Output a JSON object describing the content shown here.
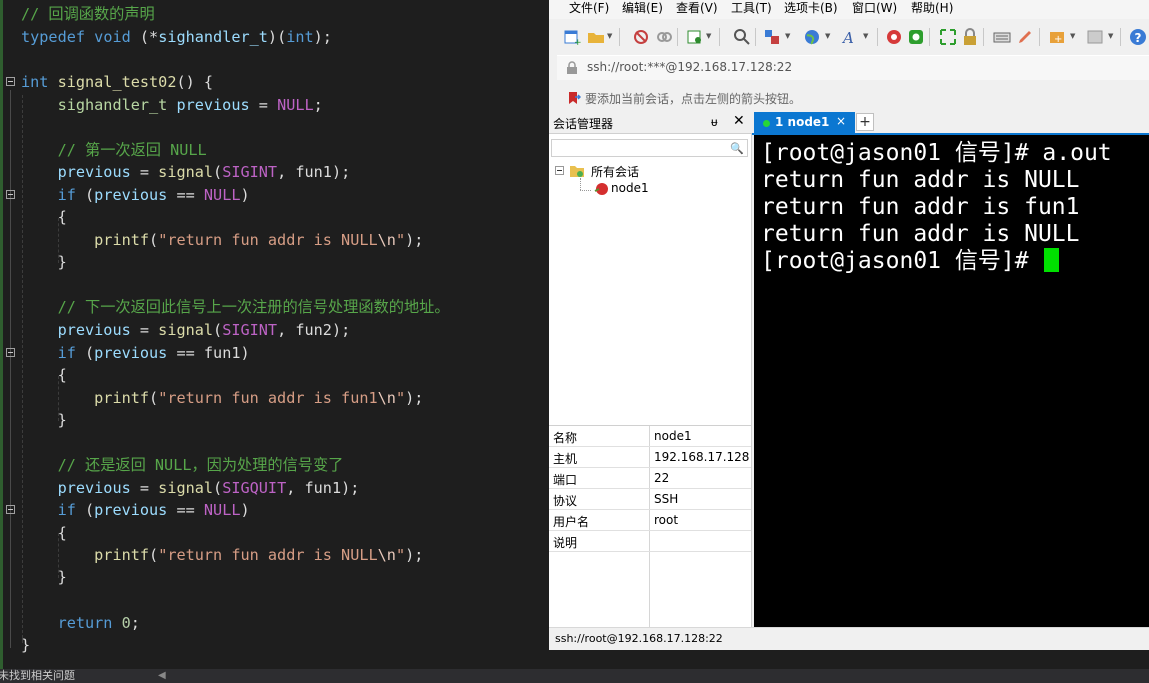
{
  "editor": {
    "lines": [
      {
        "cm": "// 回调函数的声明"
      },
      {
        "kw": "typedef",
        "ty": "void",
        "rest_a": " (*",
        "id": "sighandler_t",
        "rest_b": ")(",
        "kw2": "int",
        "rest_c": ");"
      },
      {},
      {
        "kw": "int",
        "fn": "signal_test02",
        "rest": "() {"
      },
      {
        "ty": "sighandler_t",
        "vr": "previous",
        "rest": " = ",
        "mc": "NULL",
        "end": ";"
      },
      {},
      {
        "cm": "// 第一次返回 NULL"
      },
      {
        "vr": "previous",
        "rest": " = ",
        "fn": "signal",
        "args": "SIGINT",
        "args2": "fun1",
        "end": ");"
      },
      {
        "kw": "if",
        "vr": "previous",
        "mc": "NULL"
      },
      {
        "p": "{"
      },
      {
        "fn": "printf",
        "st": "\"return fun addr is NULL",
        "es": "\\n",
        "st2": "\"",
        "end": ");"
      },
      {
        "p": "}"
      },
      {},
      {
        "cm": "// 下一次返回此信号上一次注册的信号处理函数的地址。"
      },
      {
        "vr": "previous",
        "rest": " = ",
        "fn": "signal",
        "args": "SIGINT",
        "args2": "fun2",
        "end": ");"
      },
      {
        "kw": "if",
        "vr": "previous",
        "id": "fun1"
      },
      {
        "p": "{"
      },
      {
        "fn": "printf",
        "st": "\"return fun addr is fun1",
        "es": "\\n",
        "st2": "\"",
        "end": ");"
      },
      {
        "p": "}"
      },
      {},
      {
        "cm": "// 还是返回 NULL，因为处理的信号变了"
      },
      {
        "vr": "previous",
        "rest": " = ",
        "fn": "signal",
        "args": "SIGQUIT",
        "args2": "fun1",
        "end": ");"
      },
      {
        "kw": "if",
        "vr": "previous",
        "mc": "NULL"
      },
      {
        "p": "{"
      },
      {
        "fn": "printf",
        "st": "\"return fun addr is NULL",
        "es": "\\n",
        "st2": "\"",
        "end": ");"
      },
      {
        "p": "}"
      },
      {},
      {
        "kw": "return",
        "nu": "0",
        "end": ";"
      },
      {
        "p": "}"
      }
    ],
    "status_text": "未找到相关问题"
  },
  "xshell": {
    "menu": [
      "文件(F)",
      "编辑(E)",
      "查看(V)",
      "工具(T)",
      "选项卡(B)",
      "窗口(W)",
      "帮助(H)"
    ],
    "address": "ssh://root:***@192.168.17.128:22",
    "hint": "要添加当前会话，点击左侧的箭头按钮。",
    "session_manager": {
      "title": "会话管理器",
      "pin": "ᵾ",
      "close": "✕",
      "tree_root": "所有会话",
      "tree_child": "node1"
    },
    "properties": [
      {
        "k": "名称",
        "v": "node1"
      },
      {
        "k": "主机",
        "v": "192.168.17.128"
      },
      {
        "k": "端口",
        "v": "22"
      },
      {
        "k": "协议",
        "v": "SSH"
      },
      {
        "k": "用户名",
        "v": "root"
      },
      {
        "k": "说明",
        "v": ""
      }
    ],
    "tab": {
      "label": "1 node1",
      "close": "×",
      "add": "+"
    },
    "terminal_lines": [
      "[root@jason01 信号]# a.out",
      "return fun addr is NULL",
      "return fun addr is fun1",
      "return fun addr is NULL",
      "[root@jason01 信号]# "
    ],
    "status": "ssh://root@192.168.17.128:22",
    "colors": {
      "accent": "#0b77d1",
      "cursor": "#00e000",
      "tab_dot": "#27d637"
    }
  }
}
